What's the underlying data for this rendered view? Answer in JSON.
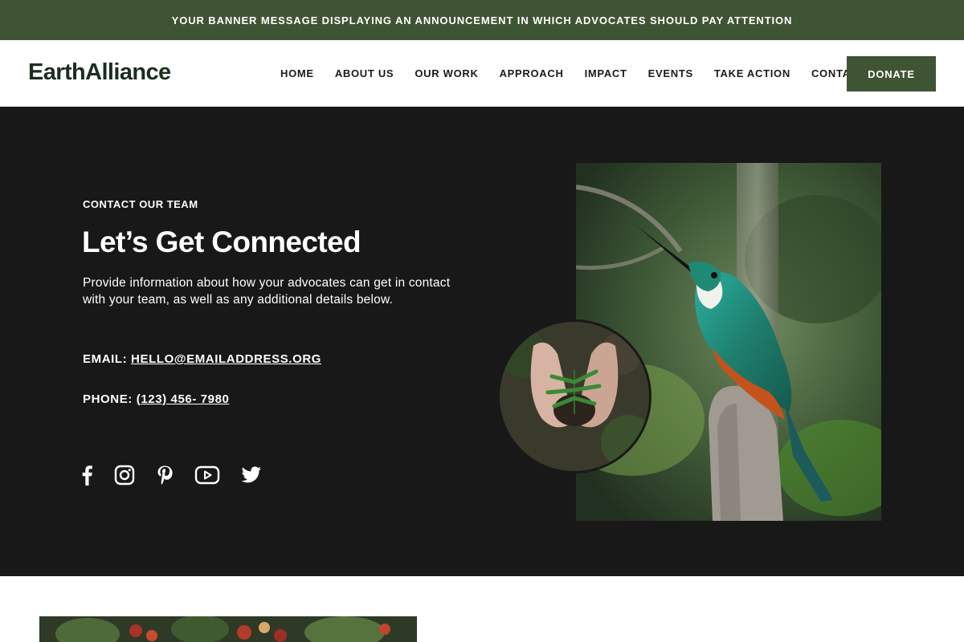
{
  "banner": {
    "text": "YOUR BANNER MESSAGE DISPLAYING AN ANNOUNCEMENT IN WHICH ADVOCATES SHOULD PAY ATTENTION"
  },
  "header": {
    "logo": "EarthAlliance",
    "nav": [
      "HOME",
      "ABOUT US",
      "OUR WORK",
      "APPROACH",
      "IMPACT",
      "EVENTS",
      "TAKE ACTION",
      "CONTACT"
    ],
    "donate_label": "DONATE"
  },
  "hero": {
    "eyebrow": "CONTACT OUR TEAM",
    "headline": "Let’s Get Connected",
    "description": "Provide information about how your advocates can get in contact with your team, as well as any additional details below.",
    "email_label": "EMAIL:",
    "email_value": "HELLO@EMAILADDRESS.ORG",
    "phone_label": "PHONE:",
    "phone_value": "(123) 456- 7980",
    "socials": [
      "facebook-icon",
      "instagram-icon",
      "pinterest-icon",
      "youtube-icon",
      "twitter-icon"
    ]
  },
  "colors": {
    "brand_green": "#3f5434",
    "hero_background": "#181818",
    "logo_text": "#1c2e1f"
  }
}
